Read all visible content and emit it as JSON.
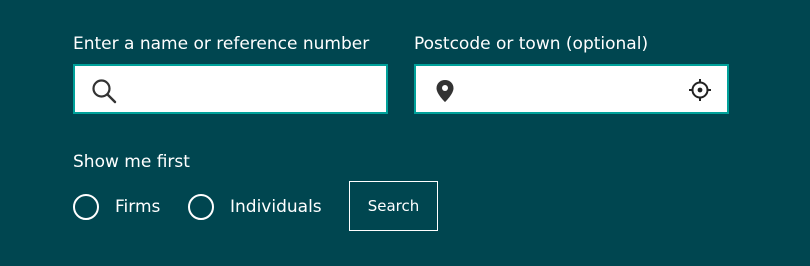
{
  "search_form": {
    "name_field": {
      "label": "Enter a name or reference number",
      "value": "",
      "placeholder": "",
      "icon": "search-icon"
    },
    "location_field": {
      "label": "Postcode or town (optional)",
      "value": "",
      "placeholder": "",
      "icon": "map-pin-icon",
      "action_icon": "locate-me-icon"
    },
    "show_me_first": {
      "label": "Show me first",
      "options": [
        {
          "label": "Firms",
          "selected": false
        },
        {
          "label": "Individuals",
          "selected": false
        }
      ]
    },
    "search_button_label": "Search"
  },
  "colors": {
    "background": "#004650",
    "input_border": "#00a19a",
    "input_background": "#ffffff",
    "icon": "#333333",
    "text": "#ffffff"
  }
}
